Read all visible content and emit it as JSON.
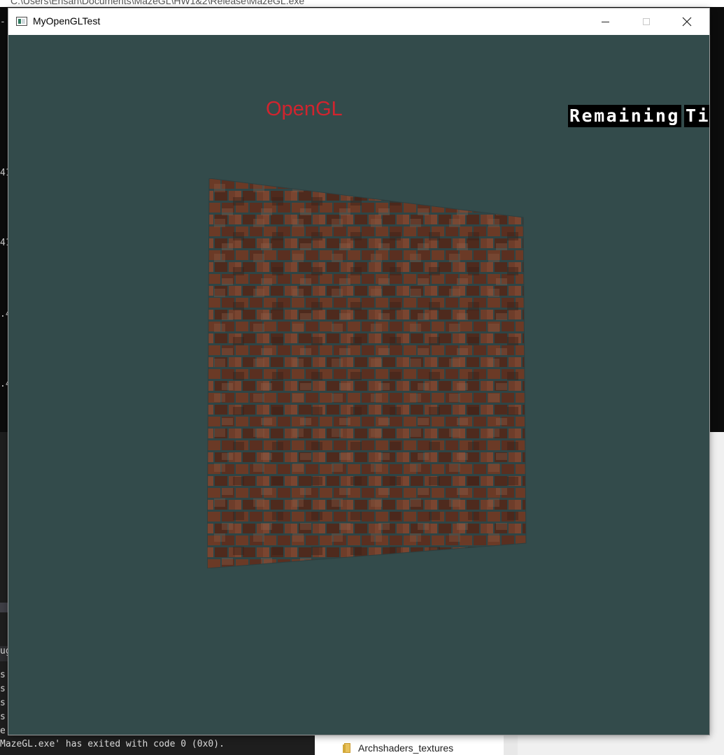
{
  "background": {
    "console_title": "C:\\Users\\Ehsan\\Documents\\MazeGL\\HW1&2\\Release\\MazeGL.exe",
    "console_side_glyphs": [
      "- P",
      "41",
      "41",
      ".4",
      ".4"
    ],
    "ide_output_lines": [
      "s",
      "s",
      "s",
      "s",
      "e"
    ],
    "ide_tab_fragment": "ug",
    "ide_exit_message": "MazeGL.exe' has exited with code 0 (0x0).",
    "explorer_folder": "Archshaders_textures"
  },
  "window": {
    "title": "MyOpenGLTest",
    "icon": "app-window-icon",
    "minimize_icon": "minimize-icon",
    "maximize_icon": "maximize-icon",
    "close_icon": "close-icon"
  },
  "scene": {
    "background_color": "#334b4b",
    "label": "OpenGL",
    "label_color": "#d1242e",
    "timer_words": [
      "Remaining",
      "Ti"
    ],
    "wall_texture": "brick-wall"
  }
}
